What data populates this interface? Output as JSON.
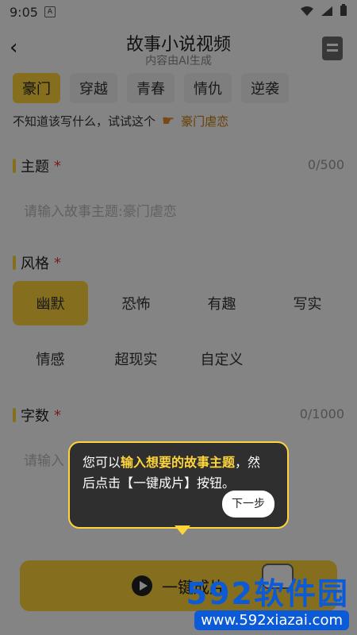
{
  "status_bar": {
    "time": "9:05",
    "app_badge": "A",
    "icons": [
      "wifi-icon",
      "signal-icon",
      "battery-icon"
    ]
  },
  "header": {
    "title": "故事小说视频",
    "subtitle": "内容由AI生成",
    "back_icon": "chevron-left-icon",
    "doc_icon": "document-icon"
  },
  "tabs": [
    {
      "label": "豪门",
      "active": true
    },
    {
      "label": "穿越"
    },
    {
      "label": "青春"
    },
    {
      "label": "情仇"
    },
    {
      "label": "逆袭"
    }
  ],
  "hint": {
    "text": "不知道该写什么，试试这个",
    "hand_icon": "pointing-hand-icon",
    "suggestion": "豪门虐恋"
  },
  "topic": {
    "label": "主题",
    "required": "*",
    "count": "0/500",
    "placeholder": "请输入故事主题:豪门虐恋"
  },
  "style": {
    "label": "风格",
    "required": "*",
    "options": [
      {
        "label": "幽默",
        "selected": true
      },
      {
        "label": "恐怖"
      },
      {
        "label": "有趣"
      },
      {
        "label": "写实"
      },
      {
        "label": "情感"
      },
      {
        "label": "超现实"
      },
      {
        "label": "自定义"
      }
    ]
  },
  "words": {
    "label": "字数",
    "required": "*",
    "count": "0/1000",
    "placeholder": "请输入"
  },
  "tooltip": {
    "line1_prefix": "您可以",
    "line1_highlight": "输入想要的故事主题",
    "line1_suffix": "，然",
    "line2": "后点击【一键成片】按钮。",
    "next_button": "下一步"
  },
  "bottom_button": {
    "label": "一键成片",
    "play_icon": "play-icon",
    "controller_icon": "gamepad-icon"
  },
  "watermark": {
    "brand_num": "592",
    "brand_cn": "软件园",
    "url": "www.592xiazai.com"
  },
  "colors": {
    "accent": "#ffd43a",
    "danger": "#e53935",
    "watermark": "#0b5ad8"
  }
}
